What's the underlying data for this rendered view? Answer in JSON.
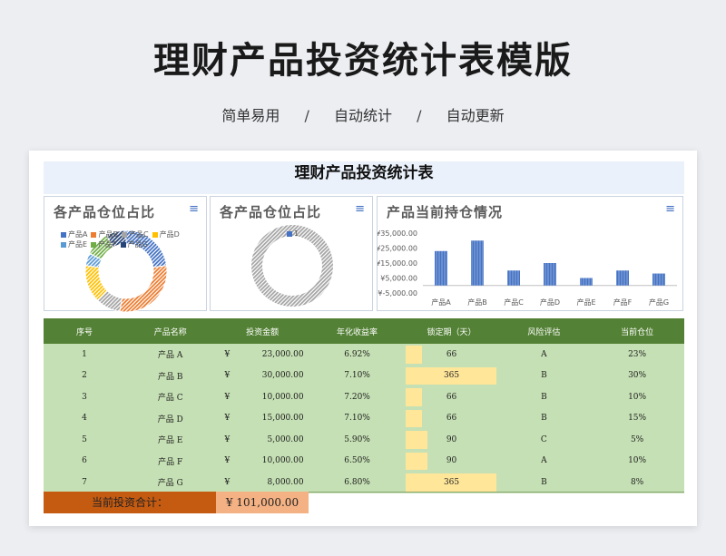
{
  "header": {
    "title": "理财产品投资统计表模版",
    "tags": [
      "简单易用",
      "自动统计",
      "自动更新"
    ],
    "separator": "/"
  },
  "sheet": {
    "title": "理财产品投资统计表"
  },
  "charts": {
    "donut1_title": "各产品仓位占比",
    "donut2_title": "各产品仓位占比",
    "donut2_legend": "1",
    "bar_title": "产品当前持仓情况",
    "menu_icon": "≡"
  },
  "chart_data": [
    {
      "type": "pie",
      "title": "各产品仓位占比",
      "categories": [
        "产品A",
        "产品B",
        "产品C",
        "产品D",
        "产品E",
        "产品F",
        "产品G"
      ],
      "values": [
        23,
        30,
        10,
        15,
        5,
        10,
        8
      ],
      "colors": [
        "#4472c4",
        "#ed7d31",
        "#a5a5a5",
        "#ffc000",
        "#5b9bd5",
        "#70ad47",
        "#264478"
      ]
    },
    {
      "type": "pie",
      "title": "各产品仓位占比",
      "categories": [
        "1"
      ],
      "values": [
        100
      ],
      "colors": [
        "#4472c4"
      ]
    },
    {
      "type": "bar",
      "title": "产品当前持仓情况",
      "categories": [
        "产品A",
        "产品B",
        "产品C",
        "产品D",
        "产品E",
        "产品F",
        "产品G"
      ],
      "values": [
        23000,
        30000,
        10000,
        15000,
        5000,
        10000,
        8000
      ],
      "yticks": [
        "¥35,000.00",
        "¥25,000.00",
        "¥15,000.00",
        "¥5,000.00",
        "¥-5,000.00"
      ],
      "ylim": [
        -5000,
        35000
      ],
      "color": "#4472c4"
    }
  ],
  "table": {
    "headers": [
      "序号",
      "产品名称",
      "投资金额",
      "年化收益率",
      "锁定期（天）",
      "风险评估",
      "当前仓位"
    ],
    "currency": "¥",
    "lock_max": 365,
    "rows": [
      {
        "no": "1",
        "name": "产品 A",
        "amount": "23,000.00",
        "rate": "6.92%",
        "lock": 66,
        "risk": "A",
        "pos": "23%"
      },
      {
        "no": "2",
        "name": "产品 B",
        "amount": "30,000.00",
        "rate": "7.10%",
        "lock": 365,
        "risk": "B",
        "pos": "30%"
      },
      {
        "no": "3",
        "name": "产品 C",
        "amount": "10,000.00",
        "rate": "7.20%",
        "lock": 66,
        "risk": "B",
        "pos": "10%"
      },
      {
        "no": "4",
        "name": "产品 D",
        "amount": "15,000.00",
        "rate": "7.10%",
        "lock": 66,
        "risk": "B",
        "pos": "15%"
      },
      {
        "no": "5",
        "name": "产品 E",
        "amount": "5,000.00",
        "rate": "5.90%",
        "lock": 90,
        "risk": "C",
        "pos": "5%"
      },
      {
        "no": "6",
        "name": "产品 F",
        "amount": "10,000.00",
        "rate": "6.50%",
        "lock": 90,
        "risk": "A",
        "pos": "10%"
      },
      {
        "no": "7",
        "name": "产品 G",
        "amount": "8,000.00",
        "rate": "6.80%",
        "lock": 365,
        "risk": "B",
        "pos": "8%"
      }
    ]
  },
  "total": {
    "label": "当前投资合计：",
    "value": "¥ 101,000.00"
  }
}
